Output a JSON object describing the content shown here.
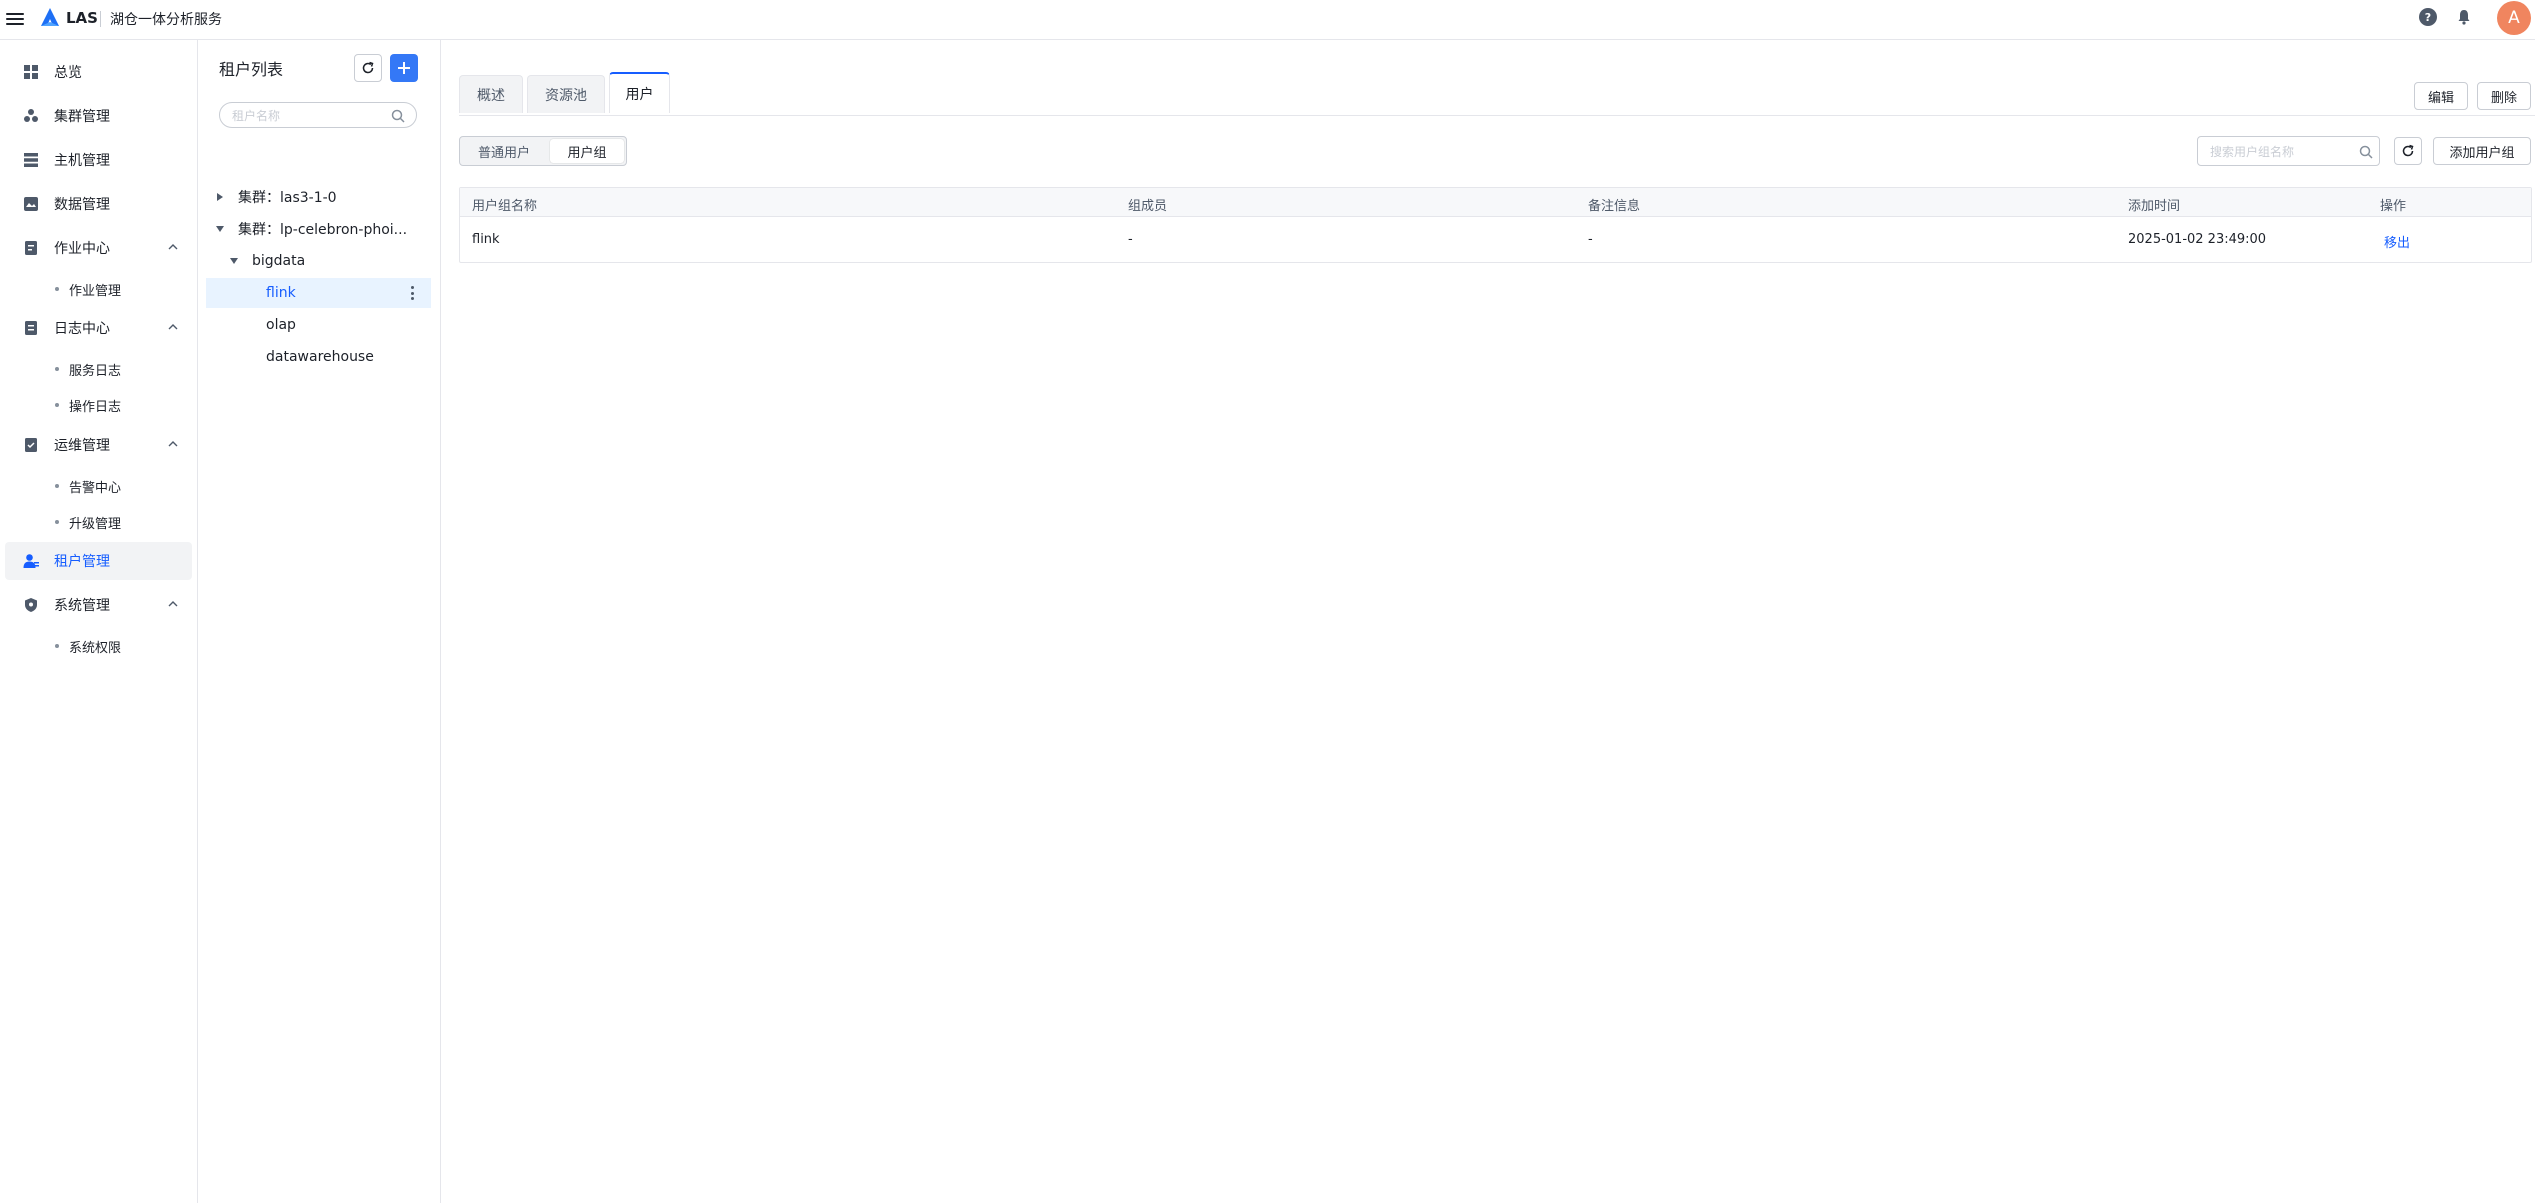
{
  "app": {
    "brand": "LAS",
    "subtitle": "湖仓一体分析服务",
    "avatar_letter": "A",
    "accent_color": "#165dff"
  },
  "sidebar": {
    "items": [
      {
        "label": "总览",
        "icon": "dashboard-icon"
      },
      {
        "label": "集群管理",
        "icon": "cluster-icon"
      },
      {
        "label": "主机管理",
        "icon": "server-icon"
      },
      {
        "label": "数据管理",
        "icon": "database-icon"
      },
      {
        "label": "作业中心",
        "icon": "job-icon",
        "children": [
          "作业管理"
        ]
      },
      {
        "label": "日志中心",
        "icon": "log-icon",
        "children": [
          "服务日志",
          "操作日志"
        ]
      },
      {
        "label": "运维管理",
        "icon": "ops-icon",
        "children": [
          "告警中心",
          "升级管理"
        ]
      },
      {
        "label": "租户管理",
        "icon": "tenant-icon",
        "active": true
      },
      {
        "label": "系统管理",
        "icon": "shield-icon",
        "children": [
          "系统权限"
        ]
      }
    ]
  },
  "tenant_panel": {
    "title": "租户列表",
    "search_placeholder": "租户名称",
    "tree": [
      {
        "label": "集群：las3-1-0",
        "expanded": false
      },
      {
        "label": "集群：lp-celebron-phoi...",
        "expanded": true
      },
      {
        "label": "bigdata",
        "expanded": true
      },
      {
        "label": "flink",
        "selected": true
      },
      {
        "label": "olap"
      },
      {
        "label": "datawarehouse"
      }
    ]
  },
  "main": {
    "tabs": [
      "概述",
      "资源池",
      "用户"
    ],
    "active_tab": "用户",
    "edit_label": "编辑",
    "delete_label": "删除",
    "segments": [
      "普通用户",
      "用户组"
    ],
    "active_segment": "用户组",
    "search_placeholder": "搜索用户组名称",
    "add_group_label": "添加用户组",
    "table": {
      "columns": [
        "用户组名称",
        "组成员",
        "备注信息",
        "添加时间",
        "操作"
      ],
      "rows": [
        [
          "flink",
          "-",
          "-",
          "2025-01-02 23:49:00",
          "移出"
        ]
      ]
    }
  }
}
